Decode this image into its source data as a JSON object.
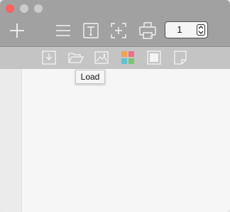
{
  "window": {
    "controls": [
      "close",
      "minimize",
      "maximize"
    ],
    "colors": {
      "close": "#fc615d",
      "inactive": "#cbcbcb",
      "toolbar": "#a1a1a1",
      "subtoolbar": "#c4c4c4"
    }
  },
  "toolbar": {
    "icons": [
      "plus-icon",
      "menu-icon",
      "text-icon",
      "crop-icon",
      "print-icon"
    ],
    "page_stepper": {
      "value": "1"
    }
  },
  "subtoolbar": {
    "icons": [
      "download-icon",
      "folder-open-icon",
      "image-icon",
      "color-grid-icon",
      "frame-icon",
      "page-icon"
    ],
    "color_grid_colors": [
      "#f0a24c",
      "#ef6f8a",
      "#5fc2d6",
      "#7ac66a"
    ]
  },
  "tooltip": {
    "text": "Load"
  }
}
